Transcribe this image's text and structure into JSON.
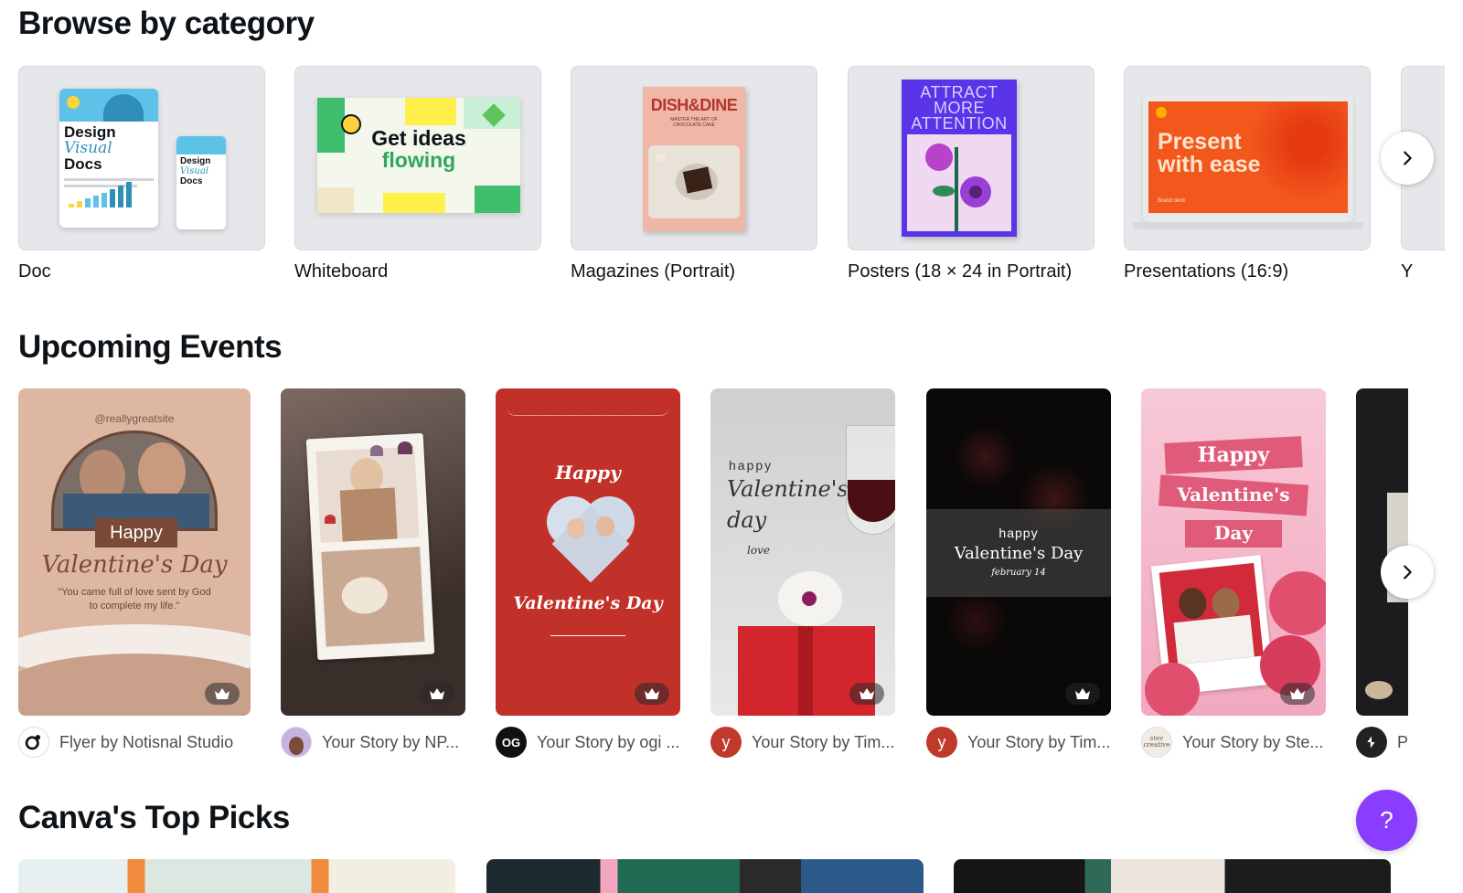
{
  "sections": {
    "browse_title": "Browse by category",
    "events_title": "Upcoming Events",
    "picks_title": "Canva's Top Picks"
  },
  "categories": [
    {
      "label": "Doc",
      "thumb_text": [
        "Design",
        "Visual",
        "Docs"
      ]
    },
    {
      "label": "Whiteboard",
      "thumb_text": [
        "Get ideas",
        "flowing"
      ]
    },
    {
      "label": "Magazines (Portrait)",
      "thumb_text": [
        "DISH&DINE",
        "MASTER THE ART OF CHOCOLATE CAKE"
      ]
    },
    {
      "label": "Posters (18 × 24 in Portrait)",
      "thumb_text": [
        "ATTRACT",
        "MORE",
        "ATTENTION"
      ]
    },
    {
      "label": "Presentations (16:9)",
      "thumb_text": [
        "Present",
        "with ease",
        "Brand deck"
      ]
    },
    {
      "label": "Y"
    }
  ],
  "events": [
    {
      "label": "Flyer by Notisnal Studio",
      "thumb_text": [
        "@reallygreatsite",
        "Happy",
        "Valentine's Day",
        "\"You came full of love sent by God to complete my life.\""
      ]
    },
    {
      "label": "Your Story by NP..."
    },
    {
      "label": "Your Story by ogi ...",
      "thumb_text": [
        "Happy",
        "Valentine's Day"
      ],
      "avatar_text": "OG"
    },
    {
      "label": "Your Story by Tim...",
      "thumb_text": [
        "happy",
        "Valentine's",
        "day",
        "love"
      ],
      "avatar_text": "y"
    },
    {
      "label": "Your Story by Tim...",
      "thumb_text": [
        "happy",
        "Valentine's Day",
        "february 14"
      ],
      "avatar_text": "y"
    },
    {
      "label": "Your Story by Ste...",
      "thumb_text": [
        "Happy",
        "Valentine's",
        "Day"
      ],
      "avatar_text": "stev creative"
    },
    {
      "label": "P"
    }
  ],
  "help": {
    "label": "?"
  },
  "icons": {
    "next": "chevron-right-icon",
    "premium": "crown-icon"
  },
  "colors": {
    "accent": "#8b3dff",
    "text": "#0e1318",
    "muted": "#494f55"
  }
}
